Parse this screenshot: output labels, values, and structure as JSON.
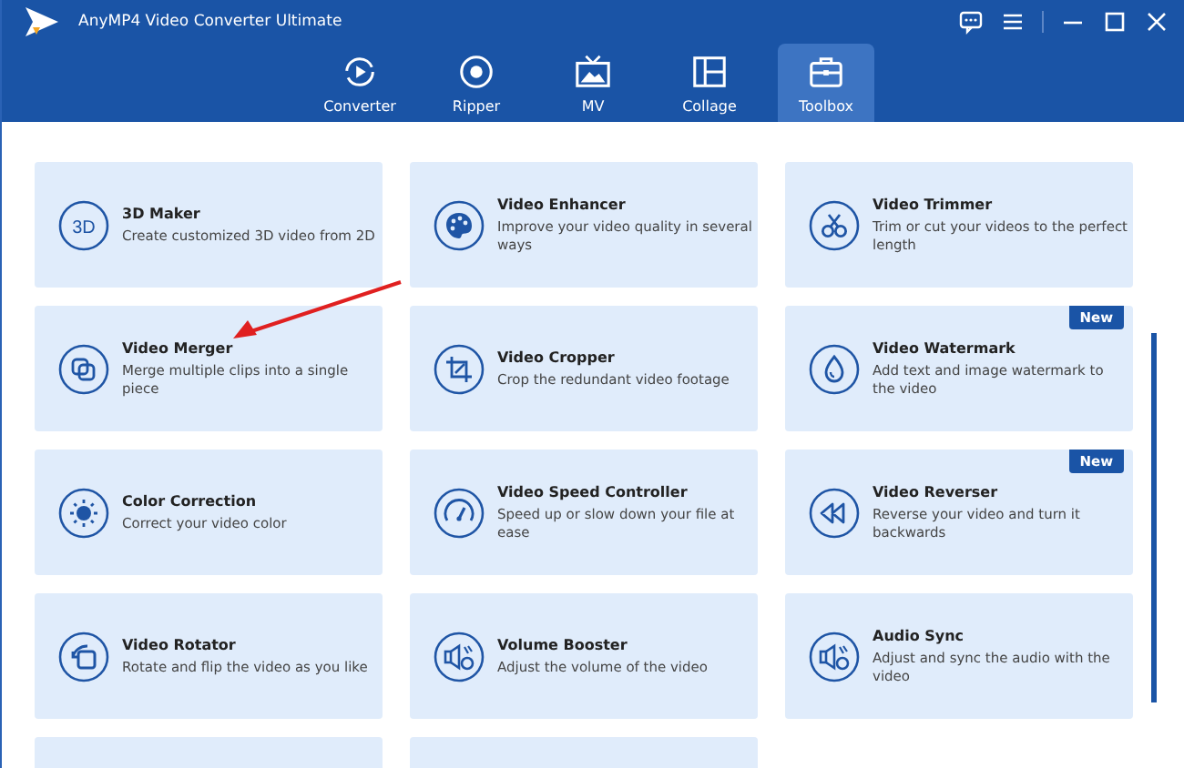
{
  "window": {
    "title": "AnyMP4 Video Converter Ultimate"
  },
  "tabs": [
    {
      "label": "Converter",
      "selected": false
    },
    {
      "label": "Ripper",
      "selected": false
    },
    {
      "label": "MV",
      "selected": false
    },
    {
      "label": "Collage",
      "selected": false
    },
    {
      "label": "Toolbox",
      "selected": true
    }
  ],
  "tools": [
    {
      "title": "3D Maker",
      "description": "Create customized 3D video from 2D",
      "icon_label": "3D"
    },
    {
      "title": "Video Enhancer",
      "description": "Improve your video quality in several ways"
    },
    {
      "title": "Video Trimmer",
      "description": "Trim or cut your videos to the perfect length"
    },
    {
      "title": "Video Merger",
      "description": "Merge multiple clips into a single piece"
    },
    {
      "title": "Video Cropper",
      "description": "Crop the redundant video footage"
    },
    {
      "title": "Video Watermark",
      "description": "Add text and image watermark to the video",
      "badge": "New"
    },
    {
      "title": "Color Correction",
      "description": "Correct your video color"
    },
    {
      "title": "Video Speed Controller",
      "description": "Speed up or slow down your file at ease"
    },
    {
      "title": "Video Reverser",
      "description": "Reverse your video and turn it backwards",
      "badge": "New"
    },
    {
      "title": "Video Rotator",
      "description": "Rotate and flip the video as you like"
    },
    {
      "title": "Volume Booster",
      "description": "Adjust the volume of the video"
    },
    {
      "title": "Audio Sync",
      "description": "Adjust and sync the audio with the video"
    }
  ]
}
